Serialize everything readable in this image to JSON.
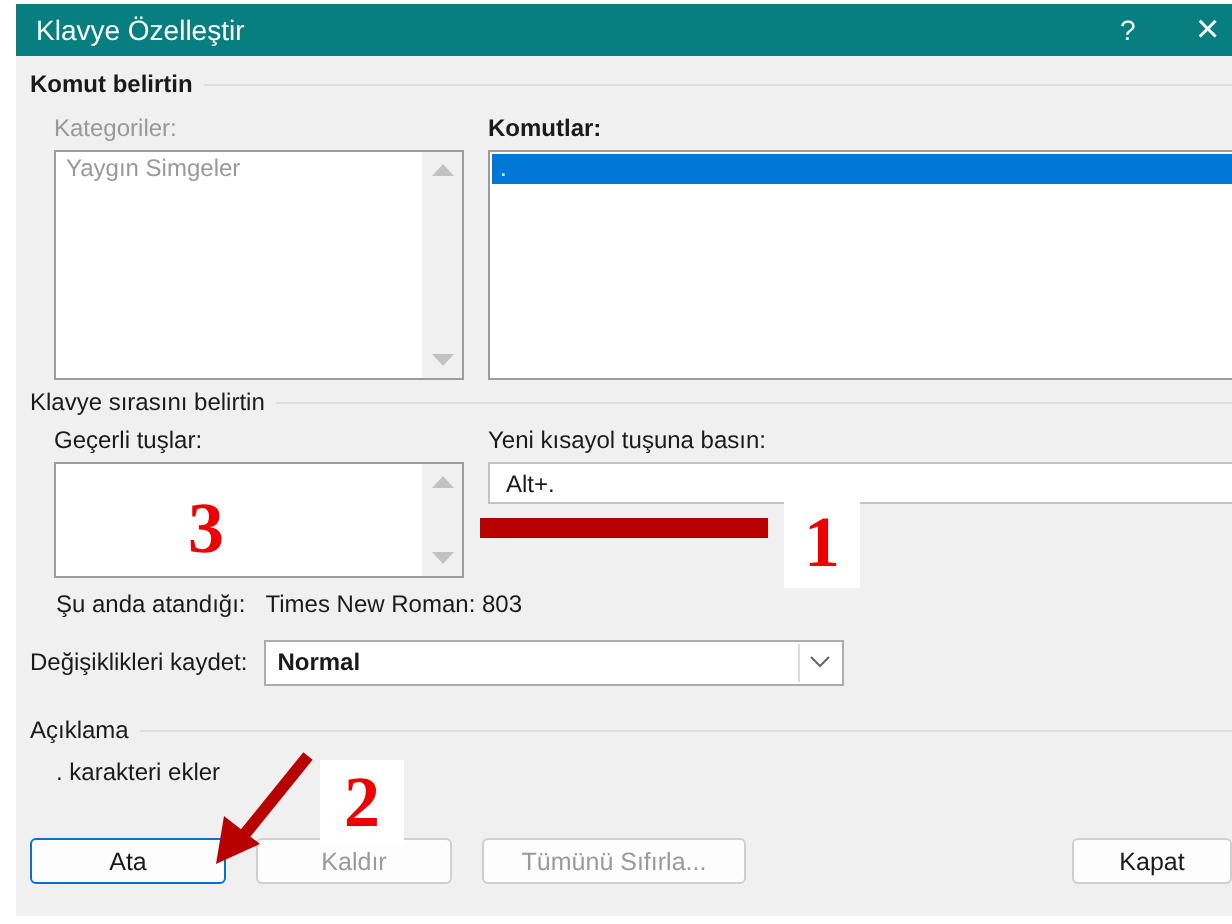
{
  "window": {
    "title": "Klavye Özelleştir",
    "help": "?",
    "close": "×"
  },
  "command_group": {
    "title": "Komut belirtin",
    "categories": {
      "label": "Kategoriler:",
      "disabled": true,
      "items": [
        {
          "label": "Yaygın Simgeler",
          "selected": false
        }
      ]
    },
    "commands": {
      "label": "Komutlar:",
      "items": [
        {
          "label": ".",
          "selected": true
        }
      ]
    }
  },
  "key_group": {
    "title": "Klavye sırasını belirtin",
    "current_keys": {
      "label": "Geçerli tuşlar:"
    },
    "new_shortcut": {
      "label": "Yeni kısayol tuşuna basın:",
      "value": "Alt+."
    },
    "assigned_label": "Şu anda atandığı:",
    "assigned_value": "Times New Roman: 803"
  },
  "save_changes": {
    "label": "Değişiklikleri kaydet:",
    "value": "Normal"
  },
  "description": {
    "title": "Açıklama",
    "text": ". karakteri ekler"
  },
  "buttons": [
    {
      "label": "Ata",
      "disabled": false,
      "focused": true
    },
    {
      "label": "Kaldır",
      "disabled": true,
      "focused": false
    },
    {
      "label": "Tümünü Sıfırla...",
      "disabled": true,
      "focused": false
    },
    {
      "label": "Kapat",
      "disabled": false,
      "focused": false
    }
  ],
  "annotations": [
    {
      "kind": "bar",
      "label": "1"
    },
    {
      "kind": "arrow",
      "label": "2"
    },
    {
      "kind": "plain",
      "label": "3"
    }
  ]
}
